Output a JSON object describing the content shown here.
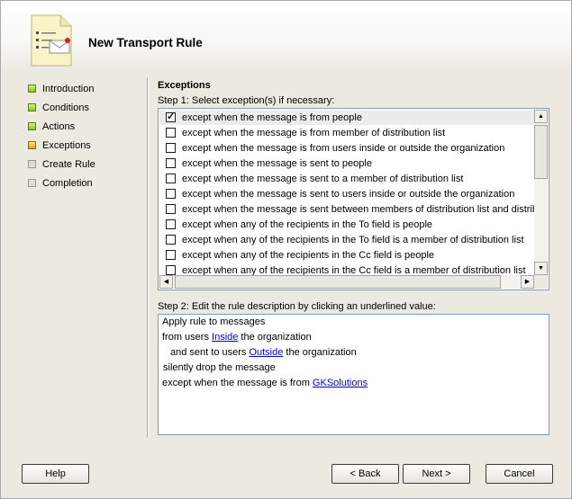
{
  "header": {
    "title": "New Transport Rule"
  },
  "steps": [
    {
      "label": "Introduction",
      "state": "complete",
      "color": "#8dc21f"
    },
    {
      "label": "Conditions",
      "state": "complete",
      "color": "#8dc21f"
    },
    {
      "label": "Actions",
      "state": "complete",
      "color": "#8dc21f"
    },
    {
      "label": "Exceptions",
      "state": "current",
      "color": "#e0a400"
    },
    {
      "label": "Create Rule",
      "state": "pending",
      "color": "#dcdcdc"
    },
    {
      "label": "Completion",
      "state": "pending",
      "color": "#dcdcdc"
    }
  ],
  "main": {
    "section_title": "Exceptions",
    "step1_label": "Step 1: Select exception(s) if necessary:",
    "exceptions": [
      {
        "label": "except when the message is from people",
        "checked": true
      },
      {
        "label": "except when the message is from member of distribution list",
        "checked": false
      },
      {
        "label": "except when the message is from users inside or outside the organization",
        "checked": false
      },
      {
        "label": "except when the message is sent to people",
        "checked": false
      },
      {
        "label": "except when the message is sent to a member of distribution list",
        "checked": false
      },
      {
        "label": "except when the message is sent to users inside or outside the organization",
        "checked": false
      },
      {
        "label": "except when the message is sent between members of distribution list and distributio",
        "checked": false
      },
      {
        "label": "except when any of the recipients in the To field is people",
        "checked": false
      },
      {
        "label": "except when any of the recipients in the To field is a member of distribution list",
        "checked": false
      },
      {
        "label": "except when any of the recipients in the Cc field is people",
        "checked": false
      },
      {
        "label": "except when any of the recipients in the Cc field is a member of distribution list",
        "checked": false
      }
    ],
    "step2_label": "Step 2: Edit the rule description by clicking an underlined value:",
    "description": {
      "line1": "Apply rule to messages",
      "line2_pre": "from users ",
      "line2_link": "Inside",
      "line2_post": " the organization",
      "line3_pre": "and sent to users ",
      "line3_link": "Outside",
      "line3_post": " the organization",
      "line4": "silently drop the message",
      "line5_pre": "except when the message is from ",
      "line5_link": "GKSolutions"
    }
  },
  "footer": {
    "help_label": "Help",
    "back_label": "< Back",
    "next_label": "Next >",
    "cancel_label": "Cancel"
  }
}
